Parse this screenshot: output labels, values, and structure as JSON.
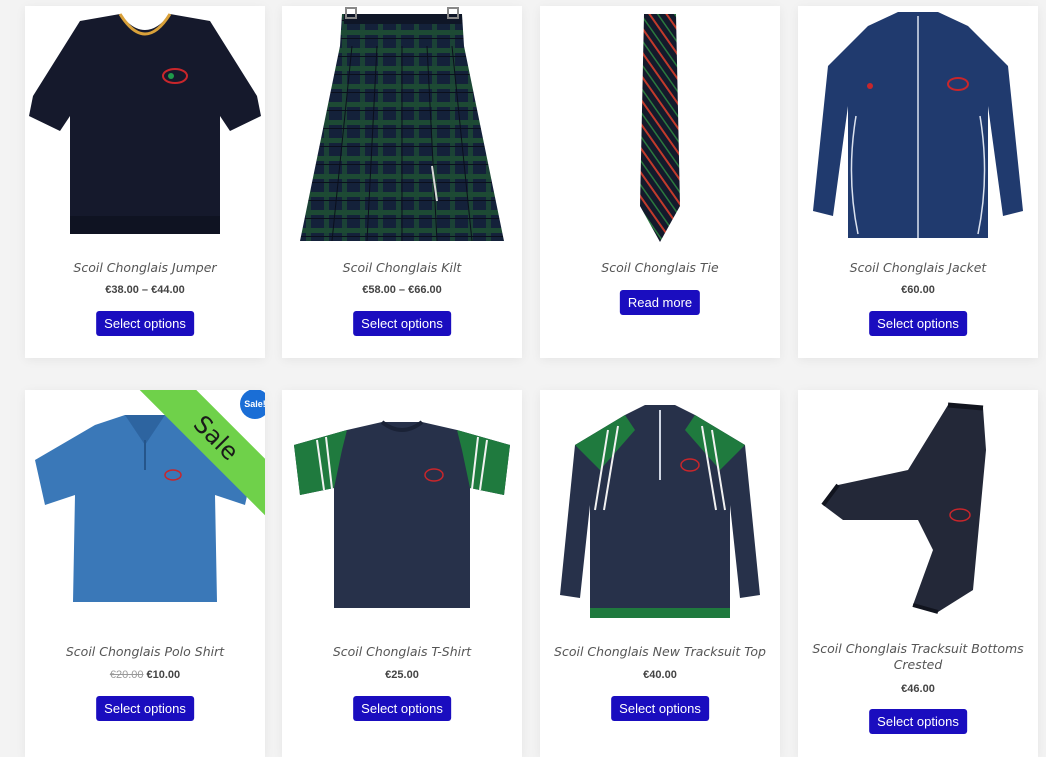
{
  "products": [
    {
      "title": "Scoil Chonglais Jumper",
      "price": "€38.00 – €44.00",
      "old_price": "",
      "button": "Select options",
      "icon": "jumper-image"
    },
    {
      "title": "Scoil Chonglais Kilt",
      "price": "€58.00 – €66.00",
      "old_price": "",
      "button": "Select options",
      "icon": "kilt-image"
    },
    {
      "title": "Scoil Chonglais Tie",
      "price": "",
      "old_price": "",
      "button": "Read more",
      "icon": "tie-image"
    },
    {
      "title": "Scoil Chonglais Jacket",
      "price": "€60.00",
      "old_price": "",
      "button": "Select options",
      "icon": "jacket-image"
    },
    {
      "title": "Scoil Chonglais Polo Shirt",
      "price": "€10.00",
      "old_price": "€20.00",
      "button": "Select options",
      "icon": "polo-shirt-image",
      "ribbon": "Sale",
      "badge": "Sale!"
    },
    {
      "title": "Scoil Chonglais T-Shirt",
      "price": "€25.00",
      "old_price": "",
      "button": "Select options",
      "icon": "t-shirt-image"
    },
    {
      "title": "Scoil Chonglais New Tracksuit Top",
      "price": "€40.00",
      "old_price": "",
      "button": "Select options",
      "icon": "tracksuit-top-image"
    },
    {
      "title": "Scoil Chonglais Tracksuit Bottoms Crested",
      "price": "€46.00",
      "old_price": "",
      "button": "Select options",
      "icon": "tracksuit-bottoms-image"
    }
  ],
  "colors": {
    "button": "#1a0dbf",
    "sale_ribbon": "#6fd14a",
    "sale_badge": "#1a6ed6",
    "navy": "#1f2a44"
  }
}
